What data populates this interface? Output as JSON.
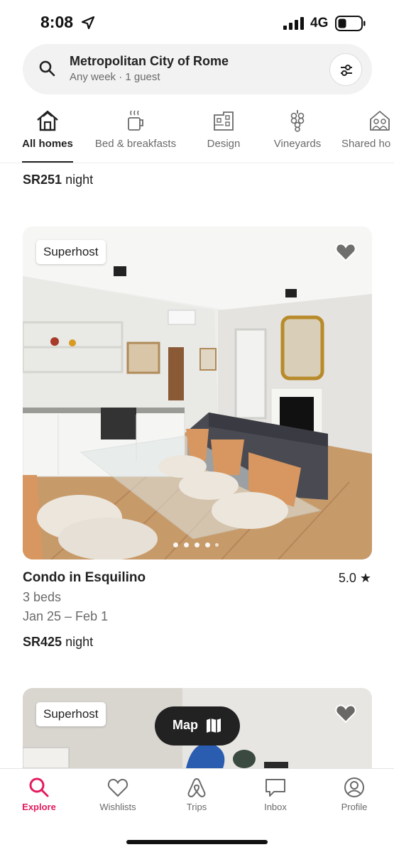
{
  "status_bar": {
    "time": "8:08",
    "network": "4G"
  },
  "search": {
    "title": "Metropolitan City of Rome",
    "subtitle": "Any week · 1 guest"
  },
  "categories": [
    {
      "label": "All homes",
      "icon": "house-icon",
      "active": true
    },
    {
      "label": "Bed & breakfasts",
      "icon": "coffee-cup-icon",
      "active": false
    },
    {
      "label": "Design",
      "icon": "building-icon",
      "active": false
    },
    {
      "label": "Vineyards",
      "icon": "grapes-icon",
      "active": false
    },
    {
      "label": "Shared ho",
      "icon": "people-house-icon",
      "active": false
    }
  ],
  "previous_listing": {
    "price": "SR251",
    "price_unit": "night"
  },
  "listings": [
    {
      "badge": "Superhost",
      "title": "Condo in Esquilino",
      "rating": "5.0",
      "beds": "3 beds",
      "dates": "Jan 25 – Feb 1",
      "price": "SR425",
      "price_unit": "night",
      "photo_count": 5,
      "active_photo": 1
    },
    {
      "badge": "Superhost"
    }
  ],
  "map_button": {
    "label": "Map"
  },
  "bottom_nav": [
    {
      "label": "Explore",
      "icon": "search-icon",
      "active": true
    },
    {
      "label": "Wishlists",
      "icon": "heart-icon",
      "active": false
    },
    {
      "label": "Trips",
      "icon": "airbnb-logo-icon",
      "active": false
    },
    {
      "label": "Inbox",
      "icon": "message-icon",
      "active": false
    },
    {
      "label": "Profile",
      "icon": "profile-icon",
      "active": false
    }
  ],
  "colors": {
    "accent": "#e31c5f",
    "text": "#222222",
    "muted": "#6a6a6a"
  }
}
